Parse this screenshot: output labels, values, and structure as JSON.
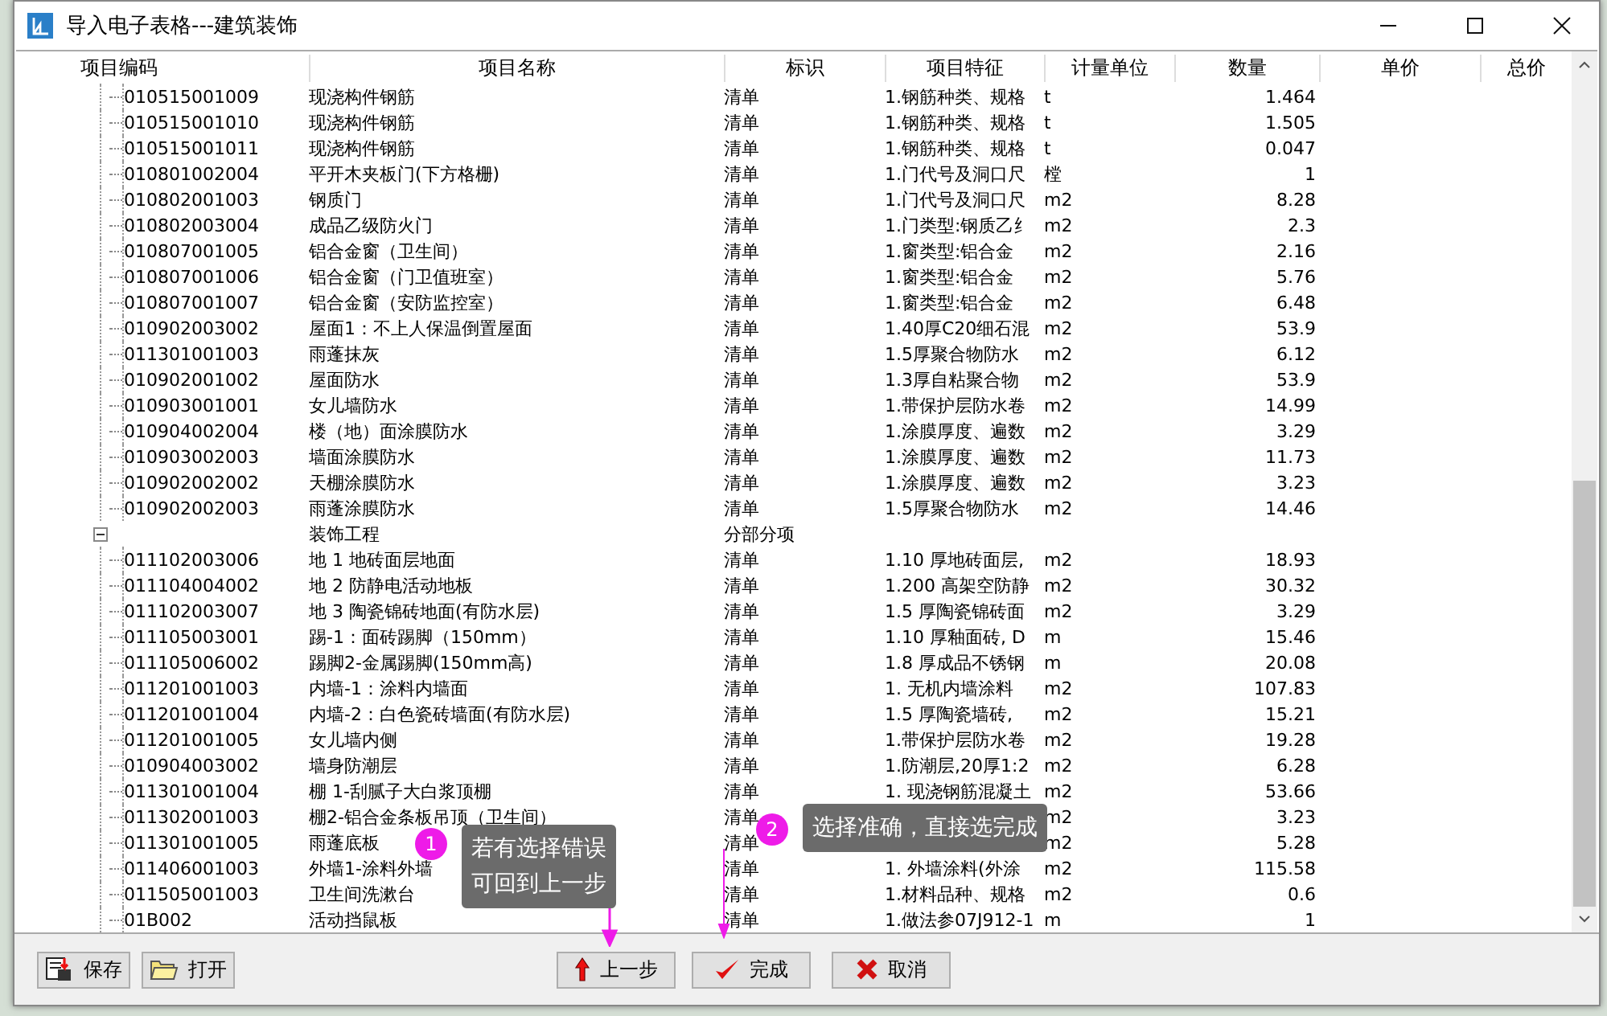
{
  "window": {
    "title": "导入电子表格---建筑装饰"
  },
  "table": {
    "columns": [
      "项目编码",
      "项目名称",
      "标识",
      "项目特征",
      "计量单位",
      "数量",
      "单价",
      "总价"
    ],
    "tree": [
      {
        "children": [
          {
            "code": "010515001009",
            "name": "现浇构件钢筋",
            "flag": "清单",
            "feature": "1.钢筋种类、规格",
            "unit": "t",
            "quantity": "1.464"
          },
          {
            "code": "010515001010",
            "name": "现浇构件钢筋",
            "flag": "清单",
            "feature": "1.钢筋种类、规格",
            "unit": "t",
            "quantity": "1.505"
          },
          {
            "code": "010515001011",
            "name": "现浇构件钢筋",
            "flag": "清单",
            "feature": "1.钢筋种类、规格",
            "unit": "t",
            "quantity": "0.047"
          },
          {
            "code": "010801002004",
            "name": "平开木夹板门(下方格栅)",
            "flag": "清单",
            "feature": "1.门代号及洞口尺",
            "unit": "樘",
            "quantity": "1"
          },
          {
            "code": "010802001003",
            "name": "钢质门",
            "flag": "清单",
            "feature": "1.门代号及洞口尺",
            "unit": "m2",
            "quantity": "8.28"
          },
          {
            "code": "010802003004",
            "name": "成品乙级防火门",
            "flag": "清单",
            "feature": "1.门类型:钢质乙纟",
            "unit": "m2",
            "quantity": "2.3"
          },
          {
            "code": "010807001005",
            "name": "铝合金窗（卫生间）",
            "flag": "清单",
            "feature": "1.窗类型:铝合金",
            "unit": "m2",
            "quantity": "2.16"
          },
          {
            "code": "010807001006",
            "name": "铝合金窗（门卫值班室）",
            "flag": "清单",
            "feature": "1.窗类型:铝合金",
            "unit": "m2",
            "quantity": "5.76"
          },
          {
            "code": "010807001007",
            "name": "铝合金窗（安防监控室）",
            "flag": "清单",
            "feature": "1.窗类型:铝合金",
            "unit": "m2",
            "quantity": "6.48"
          },
          {
            "code": "010902003002",
            "name": "屋面1：不上人保温倒置屋面",
            "flag": "清单",
            "feature": "1.40厚C20细石混",
            "unit": "m2",
            "quantity": "53.9"
          },
          {
            "code": "011301001003",
            "name": "雨蓬抹灰",
            "flag": "清单",
            "feature": "1.5厚聚合物防水",
            "unit": "m2",
            "quantity": "6.12"
          },
          {
            "code": "010902001002",
            "name": "屋面防水",
            "flag": "清单",
            "feature": "1.3厚自粘聚合物",
            "unit": "m2",
            "quantity": "53.9"
          },
          {
            "code": "010903001001",
            "name": "女儿墙防水",
            "flag": "清单",
            "feature": "1.带保护层防水卷",
            "unit": "m2",
            "quantity": "14.99"
          },
          {
            "code": "010904002004",
            "name": "楼（地）面涂膜防水",
            "flag": "清单",
            "feature": "1.涂膜厚度、遍数",
            "unit": "m2",
            "quantity": "3.29"
          },
          {
            "code": "010903002003",
            "name": "墙面涂膜防水",
            "flag": "清单",
            "feature": "1.涂膜厚度、遍数",
            "unit": "m2",
            "quantity": "11.73"
          },
          {
            "code": "010902002002",
            "name": "天棚涂膜防水",
            "flag": "清单",
            "feature": "1.涂膜厚度、遍数",
            "unit": "m2",
            "quantity": "3.23"
          },
          {
            "code": "010902002003",
            "name": "雨蓬涂膜防水",
            "flag": "清单",
            "feature": "1.5厚聚合物防水",
            "unit": "m2",
            "quantity": "14.46"
          }
        ]
      },
      {
        "kind": "group",
        "name": "装饰工程",
        "flag": "分部分项",
        "expanded": true,
        "children": [
          {
            "code": "011102003006",
            "name": "地 1 地砖面层地面",
            "flag": "清单",
            "feature": "1.10 厚地砖面层,",
            "unit": "m2",
            "quantity": "18.93"
          },
          {
            "code": "011104004002",
            "name": "地 2 防静电活动地板",
            "flag": "清单",
            "feature": "1.200 高架空防静",
            "unit": "m2",
            "quantity": "30.32"
          },
          {
            "code": "011102003007",
            "name": "地 3 陶瓷锦砖地面(有防水层)",
            "flag": "清单",
            "feature": "1.5 厚陶瓷锦砖面",
            "unit": "m2",
            "quantity": "3.29"
          },
          {
            "code": "011105003001",
            "name": "踢-1：面砖踢脚（150mm）",
            "flag": "清单",
            "feature": "1.10 厚釉面砖, D",
            "unit": "m",
            "quantity": "15.46"
          },
          {
            "code": "011105006002",
            "name": "踢脚2-金属踢脚(150mm高)",
            "flag": "清单",
            "feature": "1.8 厚成品不锈钢",
            "unit": "m",
            "quantity": "20.08"
          },
          {
            "code": "011201001003",
            "name": "内墙-1：涂料内墙面",
            "flag": "清单",
            "feature": "1. 无机内墙涂料",
            "unit": "m2",
            "quantity": "107.83"
          },
          {
            "code": "011201001004",
            "name": "内墙-2：白色瓷砖墙面(有防水层)",
            "flag": "清单",
            "feature": "1.5 厚陶瓷墙砖,",
            "unit": "m2",
            "quantity": "15.21"
          },
          {
            "code": "011201001005",
            "name": "女儿墙内侧",
            "flag": "清单",
            "feature": "1.带保护层防水卷",
            "unit": "m2",
            "quantity": "19.28"
          },
          {
            "code": "010904003002",
            "name": "墙身防潮层",
            "flag": "清单",
            "feature": "1.防潮层,20厚1:2",
            "unit": "m2",
            "quantity": "6.28"
          },
          {
            "code": "011301001004",
            "name": "棚 1-刮腻子大白浆顶棚",
            "flag": "清单",
            "feature": "1. 现浇钢筋混凝土",
            "unit": "m2",
            "quantity": "53.66"
          },
          {
            "code": "011302001003",
            "name": "棚2-铝合金条板吊顶（卫生间）",
            "flag": "清单",
            "unit": "m2",
            "quantity": "3.23"
          },
          {
            "code": "011301001005",
            "name": "雨蓬底板",
            "flag": "清单",
            "unit": "m2",
            "quantity": "5.28"
          },
          {
            "code": "011406001003",
            "name": "外墙1-涂料外墙",
            "flag": "清单",
            "feature": "1. 外墙涂料(外涂",
            "unit": "m2",
            "quantity": "115.58"
          },
          {
            "code": "011505001003",
            "name": "卫生间洗漱台",
            "flag": "清单",
            "feature": "1.材料品种、规格",
            "unit": "m2",
            "quantity": "0.6"
          },
          {
            "code": "01B002",
            "name": "活动挡鼠板",
            "flag": "清单",
            "feature": "1.做法参07J912-1",
            "unit": "m",
            "quantity": "1"
          }
        ]
      }
    ]
  },
  "buttons": [
    {
      "kind": "save",
      "label": "保存"
    },
    {
      "kind": "open",
      "label": "打开"
    },
    {
      "kind": "back",
      "label": "上一步"
    },
    {
      "kind": "finish",
      "label": "完成"
    },
    {
      "kind": "cancel",
      "label": "取消"
    }
  ],
  "tips": [
    {
      "number": "1",
      "lines": [
        "若有选择错误",
        "可回到上一步"
      ]
    },
    {
      "number": "2",
      "lines": [
        "选择准确，直接选完成"
      ]
    }
  ]
}
